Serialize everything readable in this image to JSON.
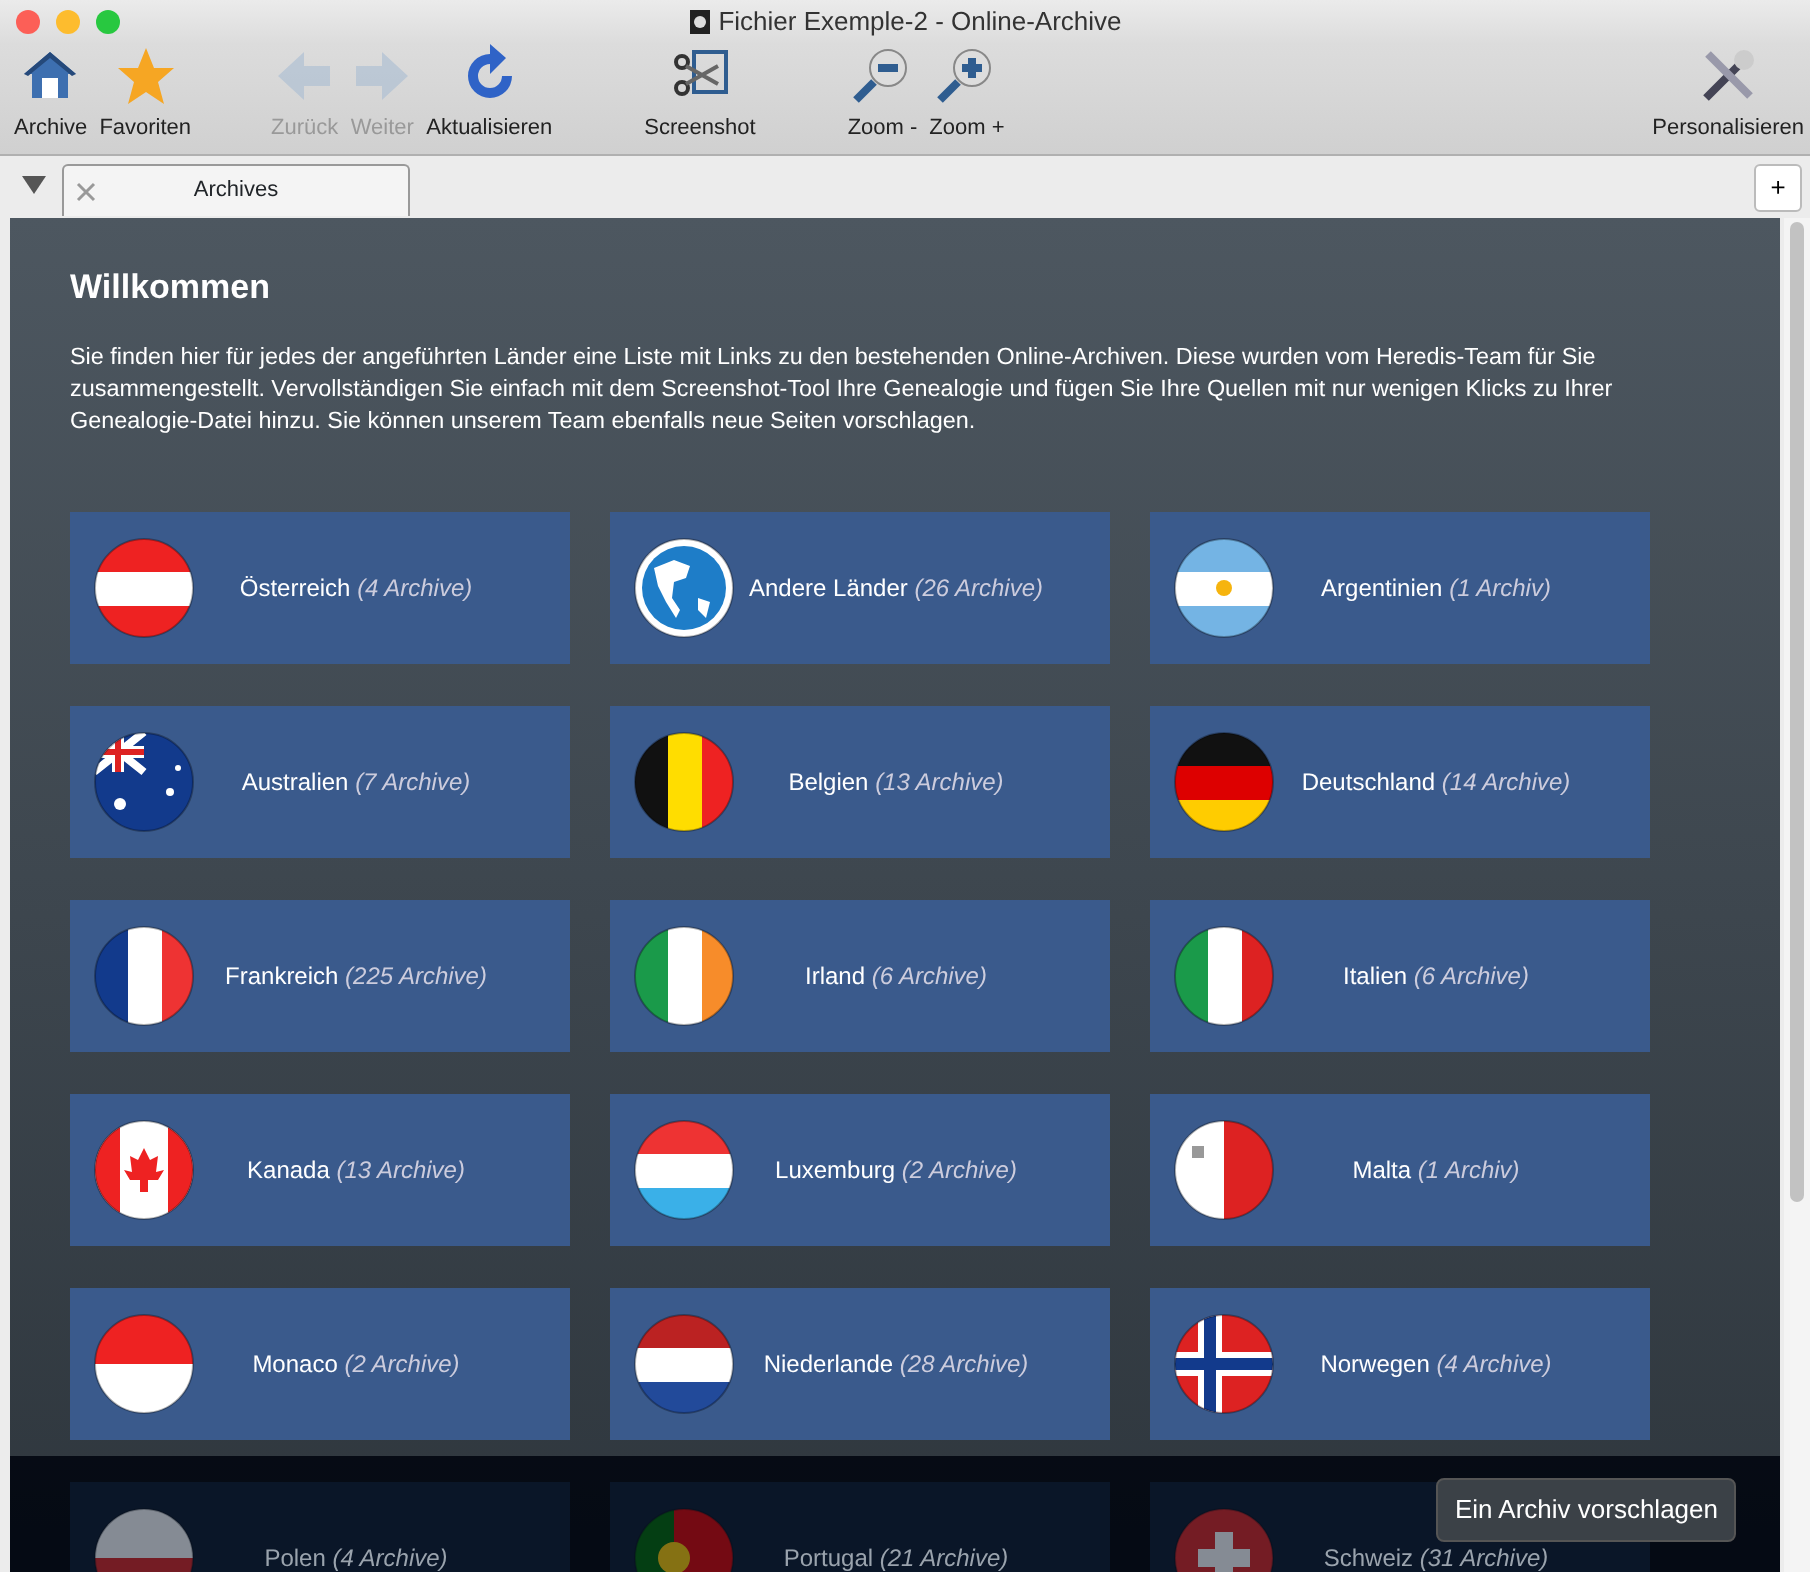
{
  "window": {
    "title": "Fichier Exemple-2 - Online-Archive"
  },
  "toolbar": [
    {
      "label": "Archive",
      "kind": "home",
      "disabled": false
    },
    {
      "label": "Favoriten",
      "kind": "star",
      "disabled": false
    },
    {
      "label": "Zurück",
      "kind": "back",
      "disabled": true
    },
    {
      "label": "Weiter",
      "kind": "forward",
      "disabled": true
    },
    {
      "label": "Aktualisieren",
      "kind": "refresh",
      "disabled": false
    },
    {
      "label": "Screenshot",
      "kind": "screenshot",
      "disabled": false
    },
    {
      "label": "Zoom -",
      "kind": "zoomout",
      "disabled": false
    },
    {
      "label": "Zoom +",
      "kind": "zoomin",
      "disabled": false
    },
    {
      "label": "Personalisieren",
      "kind": "tools",
      "disabled": false
    }
  ],
  "tabs": [
    {
      "label": "Archives",
      "selected": true
    }
  ],
  "new_tab_button": "+",
  "content": {
    "title": "Willkommen",
    "intro": "Sie finden hier für jedes der angeführten Länder eine Liste mit Links zu den bestehenden Online-Archiven. Diese wurden vom Heredis-Team für Sie zusammengestellt. Vervollständigen Sie einfach mit dem Screenshot-Tool Ihre Genealogie und fügen Sie Ihre Quellen mit nur wenigen Klicks zu Ihrer Genealogie-Datei hinzu. Sie können unserem Team ebenfalls neue Seiten vorschlagen.",
    "countries": [
      {
        "name": "Österreich",
        "count": "(4 Archive)",
        "kind": "at"
      },
      {
        "name": "Andere Länder",
        "count": "(26 Archive)",
        "kind": "globe"
      },
      {
        "name": "Argentinien",
        "count": "(1 Archiv)",
        "kind": "ar"
      },
      {
        "name": "Australien",
        "count": "(7 Archive)",
        "kind": "au"
      },
      {
        "name": "Belgien",
        "count": "(13 Archive)",
        "kind": "be"
      },
      {
        "name": "Deutschland",
        "count": "(14 Archive)",
        "kind": "de"
      },
      {
        "name": "Frankreich",
        "count": "(225 Archive)",
        "kind": "fr"
      },
      {
        "name": "Irland",
        "count": "(6 Archive)",
        "kind": "ie"
      },
      {
        "name": "Italien",
        "count": "(6 Archive)",
        "kind": "it"
      },
      {
        "name": "Kanada",
        "count": "(13 Archive)",
        "kind": "ca"
      },
      {
        "name": "Luxemburg",
        "count": "(2 Archive)",
        "kind": "lu"
      },
      {
        "name": "Malta",
        "count": "(1 Archiv)",
        "kind": "mt"
      },
      {
        "name": "Monaco",
        "count": "(2 Archive)",
        "kind": "mc"
      },
      {
        "name": "Niederlande",
        "count": "(28 Archive)",
        "kind": "nl"
      },
      {
        "name": "Norwegen",
        "count": "(4 Archive)",
        "kind": "no"
      },
      {
        "name": "Polen",
        "count": "(4 Archive)",
        "kind": "pl",
        "dimmed": true
      },
      {
        "name": "Portugal",
        "count": "(21 Archive)",
        "kind": "pt",
        "dimmed": true
      },
      {
        "name": "Schweiz",
        "count": "(31 Archive)",
        "kind": "ch",
        "dimmed": true
      }
    ]
  },
  "suggest_button": "Ein Archiv vorschlagen"
}
